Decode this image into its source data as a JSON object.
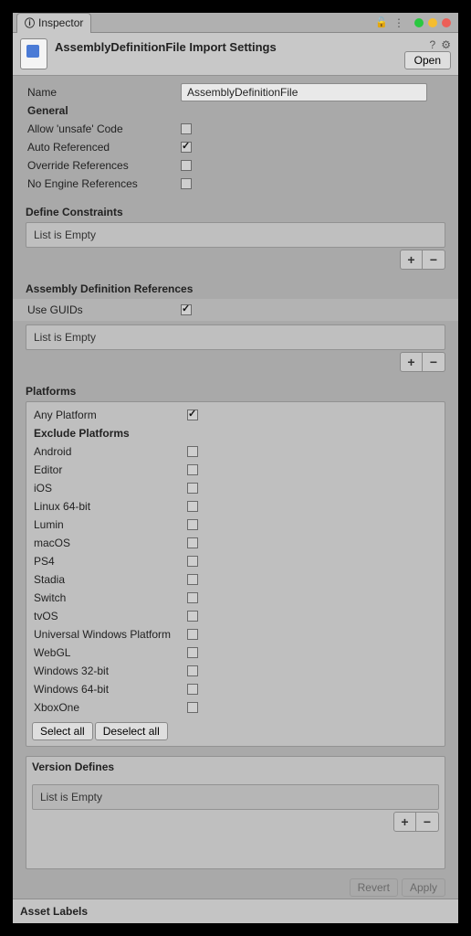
{
  "tab": {
    "label": "Inspector"
  },
  "header": {
    "title": "AssemblyDefinitionFile Import Settings",
    "open_btn": "Open"
  },
  "name": {
    "label": "Name",
    "value": "AssemblyDefinitionFile"
  },
  "general": {
    "heading": "General",
    "allow_unsafe": {
      "label": "Allow 'unsafe' Code",
      "checked": false
    },
    "auto_ref": {
      "label": "Auto Referenced",
      "checked": true
    },
    "override_ref": {
      "label": "Override References",
      "checked": false
    },
    "no_engine_ref": {
      "label": "No Engine References",
      "checked": false
    }
  },
  "define_constraints": {
    "heading": "Define Constraints",
    "empty_text": "List is Empty",
    "add": "+",
    "remove": "−"
  },
  "asm_refs": {
    "heading": "Assembly Definition References",
    "use_guids": {
      "label": "Use GUIDs",
      "checked": true
    },
    "empty_text": "List is Empty",
    "add": "+",
    "remove": "−"
  },
  "platforms": {
    "heading": "Platforms",
    "any": {
      "label": "Any Platform",
      "checked": true
    },
    "exclude_heading": "Exclude Platforms",
    "items": [
      {
        "label": "Android",
        "checked": false
      },
      {
        "label": "Editor",
        "checked": false
      },
      {
        "label": "iOS",
        "checked": false
      },
      {
        "label": "Linux 64-bit",
        "checked": false
      },
      {
        "label": "Lumin",
        "checked": false
      },
      {
        "label": "macOS",
        "checked": false
      },
      {
        "label": "PS4",
        "checked": false
      },
      {
        "label": "Stadia",
        "checked": false
      },
      {
        "label": "Switch",
        "checked": false
      },
      {
        "label": "tvOS",
        "checked": false
      },
      {
        "label": "Universal Windows Platform",
        "checked": false
      },
      {
        "label": "WebGL",
        "checked": false
      },
      {
        "label": "Windows 32-bit",
        "checked": false
      },
      {
        "label": "Windows 64-bit",
        "checked": false
      },
      {
        "label": "XboxOne",
        "checked": false
      }
    ],
    "select_all": "Select all",
    "deselect_all": "Deselect all"
  },
  "version_defines": {
    "heading": "Version Defines",
    "empty_text": "List is Empty",
    "add": "+",
    "remove": "−"
  },
  "footer": {
    "revert": "Revert",
    "apply": "Apply"
  },
  "asset_labels": {
    "heading": "Asset Labels"
  }
}
